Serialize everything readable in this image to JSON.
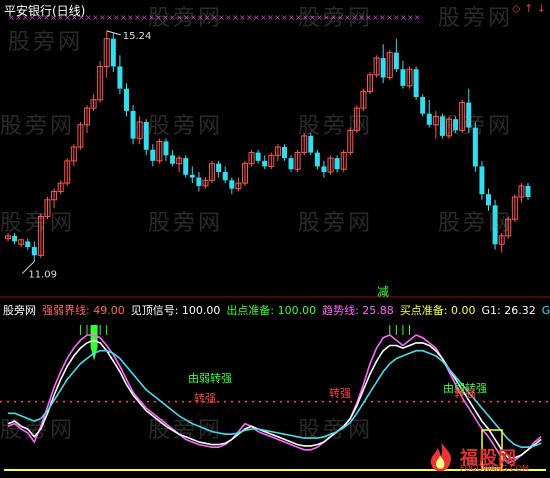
{
  "window": {
    "title": "平安银行(日线)",
    "icons": [
      "◇",
      "↑",
      "↓"
    ]
  },
  "watermark": "股旁网",
  "logo": {
    "text": "福股网",
    "sub": "FUGUWANG.COM"
  },
  "colors": {
    "up": "#ff5555",
    "down": "#33ddee",
    "line_white": "#ffffff",
    "line_magenta": "#ff66ff",
    "line_cyan": "#44ddee",
    "signal_red": "#ff3333",
    "signal_green": "#33ff33",
    "dotted": "#ff4466",
    "yellow": "#ffff33"
  },
  "legend": [
    {
      "label": "股旁网",
      "color": "#ffffff"
    },
    {
      "label": "强弱界线: 49.00",
      "color": "#ff6666"
    },
    {
      "label": "见顶信号: 100.00",
      "color": "#ffffff"
    },
    {
      "label": "出点准备: 100.00",
      "color": "#33ff33"
    },
    {
      "label": "趋势线: 25.88",
      "color": "#ff66ff"
    },
    {
      "label": "买点准备: 0.00",
      "color": "#ffff33"
    },
    {
      "label": "G1: 26.32",
      "color": "#ffffff"
    },
    {
      "label": "G",
      "color": "#44ddee"
    }
  ],
  "annotations": {
    "high_label": "15.24",
    "low_label": "11.09",
    "reduce_label": "减",
    "signals": [
      {
        "text": "由弱转强",
        "color": "#33ff33",
        "x": 210,
        "y": 382
      },
      {
        "text": "转强",
        "color": "#ff4444",
        "x": 205,
        "y": 402
      },
      {
        "text": "转强",
        "color": "#ff4444",
        "x": 340,
        "y": 397
      },
      {
        "text": "由弱转强",
        "color": "#33ff33",
        "x": 465,
        "y": 392
      },
      {
        "text": "转强",
        "color": "#ff4444",
        "x": 465,
        "y": 397
      }
    ]
  },
  "chart_data": [
    {
      "type": "candlestick",
      "title": "平安银行(日线)",
      "ylim": [
        10.9,
        15.4
      ],
      "high_marker": 15.24,
      "low_marker": 11.09,
      "candles": [
        [
          11.5,
          11.6,
          11.45,
          11.55
        ],
        [
          11.55,
          11.6,
          11.4,
          11.45
        ],
        [
          11.4,
          11.5,
          11.35,
          11.48
        ],
        [
          11.45,
          11.5,
          11.3,
          11.35
        ],
        [
          11.35,
          11.45,
          11.09,
          11.2
        ],
        [
          11.2,
          11.95,
          11.15,
          11.9
        ],
        [
          11.9,
          12.25,
          11.85,
          12.2
        ],
        [
          12.2,
          12.4,
          12.05,
          12.35
        ],
        [
          12.35,
          12.55,
          12.3,
          12.5
        ],
        [
          12.5,
          12.95,
          12.45,
          12.9
        ],
        [
          12.9,
          13.2,
          12.8,
          13.15
        ],
        [
          13.15,
          13.6,
          13.1,
          13.55
        ],
        [
          13.55,
          13.9,
          13.4,
          13.85
        ],
        [
          13.85,
          14.1,
          13.8,
          14.0
        ],
        [
          14.0,
          14.7,
          13.95,
          14.6
        ],
        [
          14.6,
          15.24,
          14.4,
          15.1
        ],
        [
          15.1,
          15.2,
          14.5,
          14.6
        ],
        [
          14.6,
          14.8,
          14.1,
          14.2
        ],
        [
          14.2,
          14.3,
          13.7,
          13.8
        ],
        [
          13.8,
          13.9,
          13.2,
          13.3
        ],
        [
          13.3,
          13.7,
          13.2,
          13.6
        ],
        [
          13.6,
          13.65,
          13.0,
          13.1
        ],
        [
          13.1,
          13.2,
          12.8,
          12.9
        ],
        [
          12.9,
          13.3,
          12.85,
          13.25
        ],
        [
          13.25,
          13.3,
          12.9,
          13.0
        ],
        [
          13.0,
          13.1,
          12.8,
          12.85
        ],
        [
          12.85,
          13.0,
          12.7,
          12.95
        ],
        [
          12.95,
          13.0,
          12.6,
          12.65
        ],
        [
          12.65,
          12.8,
          12.5,
          12.6
        ],
        [
          12.6,
          12.7,
          12.35,
          12.45
        ],
        [
          12.45,
          12.6,
          12.4,
          12.55
        ],
        [
          12.55,
          12.9,
          12.5,
          12.85
        ],
        [
          12.85,
          12.9,
          12.6,
          12.7
        ],
        [
          12.7,
          12.8,
          12.5,
          12.55
        ],
        [
          12.55,
          12.6,
          12.3,
          12.4
        ],
        [
          12.4,
          12.6,
          12.35,
          12.5
        ],
        [
          12.5,
          12.9,
          12.45,
          12.85
        ],
        [
          12.85,
          13.1,
          12.8,
          13.05
        ],
        [
          13.05,
          13.1,
          12.85,
          12.9
        ],
        [
          12.9,
          13.0,
          12.75,
          12.8
        ],
        [
          12.8,
          13.05,
          12.75,
          13.0
        ],
        [
          13.0,
          13.2,
          12.9,
          13.15
        ],
        [
          13.15,
          13.2,
          12.9,
          12.95
        ],
        [
          12.95,
          13.0,
          12.7,
          12.75
        ],
        [
          12.75,
          13.1,
          12.7,
          13.05
        ],
        [
          13.05,
          13.4,
          13.0,
          13.35
        ],
        [
          13.35,
          13.4,
          13.0,
          13.05
        ],
        [
          13.05,
          13.1,
          12.75,
          12.8
        ],
        [
          12.8,
          12.9,
          12.6,
          12.7
        ],
        [
          12.7,
          13.0,
          12.65,
          12.95
        ],
        [
          12.95,
          13.0,
          12.7,
          12.75
        ],
        [
          12.75,
          13.1,
          12.7,
          13.05
        ],
        [
          13.05,
          13.5,
          13.0,
          13.45
        ],
        [
          13.45,
          13.9,
          13.4,
          13.85
        ],
        [
          13.85,
          14.2,
          13.8,
          14.15
        ],
        [
          14.15,
          14.5,
          14.1,
          14.45
        ],
        [
          14.45,
          14.8,
          14.4,
          14.75
        ],
        [
          14.75,
          15.0,
          14.3,
          14.4
        ],
        [
          14.4,
          14.9,
          14.35,
          14.85
        ],
        [
          14.85,
          15.1,
          14.5,
          14.55
        ],
        [
          14.55,
          14.7,
          14.2,
          14.25
        ],
        [
          14.25,
          14.6,
          14.2,
          14.55
        ],
        [
          14.55,
          14.6,
          14.0,
          14.05
        ],
        [
          14.05,
          14.1,
          13.7,
          13.75
        ],
        [
          13.75,
          14.0,
          13.5,
          13.55
        ],
        [
          13.55,
          13.8,
          13.3,
          13.7
        ],
        [
          13.7,
          13.75,
          13.3,
          13.35
        ],
        [
          13.35,
          13.7,
          13.3,
          13.65
        ],
        [
          13.65,
          13.7,
          13.4,
          13.45
        ],
        [
          13.45,
          14.0,
          13.4,
          13.95
        ],
        [
          13.95,
          14.2,
          13.4,
          13.5
        ],
        [
          13.5,
          13.6,
          12.7,
          12.8
        ],
        [
          12.8,
          12.9,
          12.2,
          12.3
        ],
        [
          12.3,
          12.4,
          12.0,
          12.1
        ],
        [
          12.1,
          12.2,
          11.3,
          11.4
        ],
        [
          11.4,
          11.6,
          11.25,
          11.55
        ],
        [
          11.55,
          11.9,
          11.5,
          11.85
        ],
        [
          11.85,
          12.3,
          11.8,
          12.25
        ],
        [
          12.25,
          12.5,
          12.15,
          12.45
        ],
        [
          12.45,
          12.5,
          12.2,
          12.25
        ]
      ]
    },
    {
      "type": "line",
      "title": "",
      "ylim": [
        -5,
        110
      ],
      "series": [
        {
          "name": "强弱界线",
          "color": "#ff6666",
          "values": [
            49
          ]
        },
        {
          "name": "趋势线",
          "color": "#ff66ff",
          "values": [
            30,
            32,
            28,
            25,
            18,
            30,
            45,
            60,
            72,
            82,
            90,
            96,
            100,
            100,
            98,
            92,
            85,
            76,
            66,
            56,
            50,
            44,
            40,
            36,
            32,
            28,
            24,
            20,
            18,
            16,
            15,
            14,
            14,
            16,
            20,
            26,
            32,
            30,
            26,
            24,
            22,
            20,
            18,
            16,
            14,
            12,
            12,
            14,
            18,
            22,
            26,
            30,
            36,
            48,
            62,
            78,
            90,
            98,
            100,
            96,
            92,
            96,
            100,
            98,
            94,
            90,
            82,
            72,
            62,
            52,
            44,
            36,
            28,
            22,
            14,
            6,
            2,
            4,
            8,
            12,
            18,
            22
          ]
        },
        {
          "name": "G1",
          "color": "#ffffff",
          "values": [
            32,
            34,
            30,
            28,
            22,
            28,
            40,
            54,
            66,
            76,
            84,
            90,
            94,
            96,
            94,
            88,
            80,
            72,
            62,
            54,
            48,
            42,
            38,
            34,
            30,
            27,
            24,
            22,
            20,
            18,
            17,
            16,
            16,
            17,
            20,
            24,
            28,
            30,
            28,
            26,
            24,
            22,
            20,
            18,
            16,
            15,
            15,
            16,
            18,
            22,
            26,
            30,
            36,
            46,
            58,
            70,
            80,
            88,
            92,
            92,
            90,
            92,
            94,
            94,
            92,
            88,
            82,
            74,
            66,
            58,
            50,
            42,
            34,
            28,
            20,
            12,
            6,
            6,
            8,
            12,
            16,
            20
          ]
        },
        {
          "name": "G",
          "color": "#44ddee",
          "values": [
            40,
            40,
            38,
            36,
            34,
            36,
            42,
            50,
            58,
            66,
            72,
            78,
            82,
            86,
            88,
            88,
            86,
            82,
            76,
            70,
            64,
            58,
            54,
            50,
            46,
            42,
            38,
            35,
            32,
            30,
            28,
            26,
            25,
            24,
            24,
            25,
            27,
            28,
            28,
            27,
            26,
            25,
            24,
            23,
            22,
            21,
            21,
            21,
            22,
            24,
            26,
            29,
            33,
            40,
            48,
            56,
            64,
            72,
            78,
            82,
            84,
            86,
            88,
            88,
            86,
            84,
            80,
            74,
            68,
            62,
            56,
            50,
            44,
            38,
            32,
            26,
            20,
            16,
            14,
            14,
            15,
            17
          ]
        }
      ],
      "levels": [
        {
          "name": "强弱界线",
          "value": 49
        },
        {
          "name": "lower",
          "value": 0
        }
      ],
      "signals": {
        "见顶信号": [
          13
        ],
        "出点准备": [
          11,
          12,
          14,
          15,
          58,
          59,
          60,
          61
        ]
      }
    }
  ]
}
